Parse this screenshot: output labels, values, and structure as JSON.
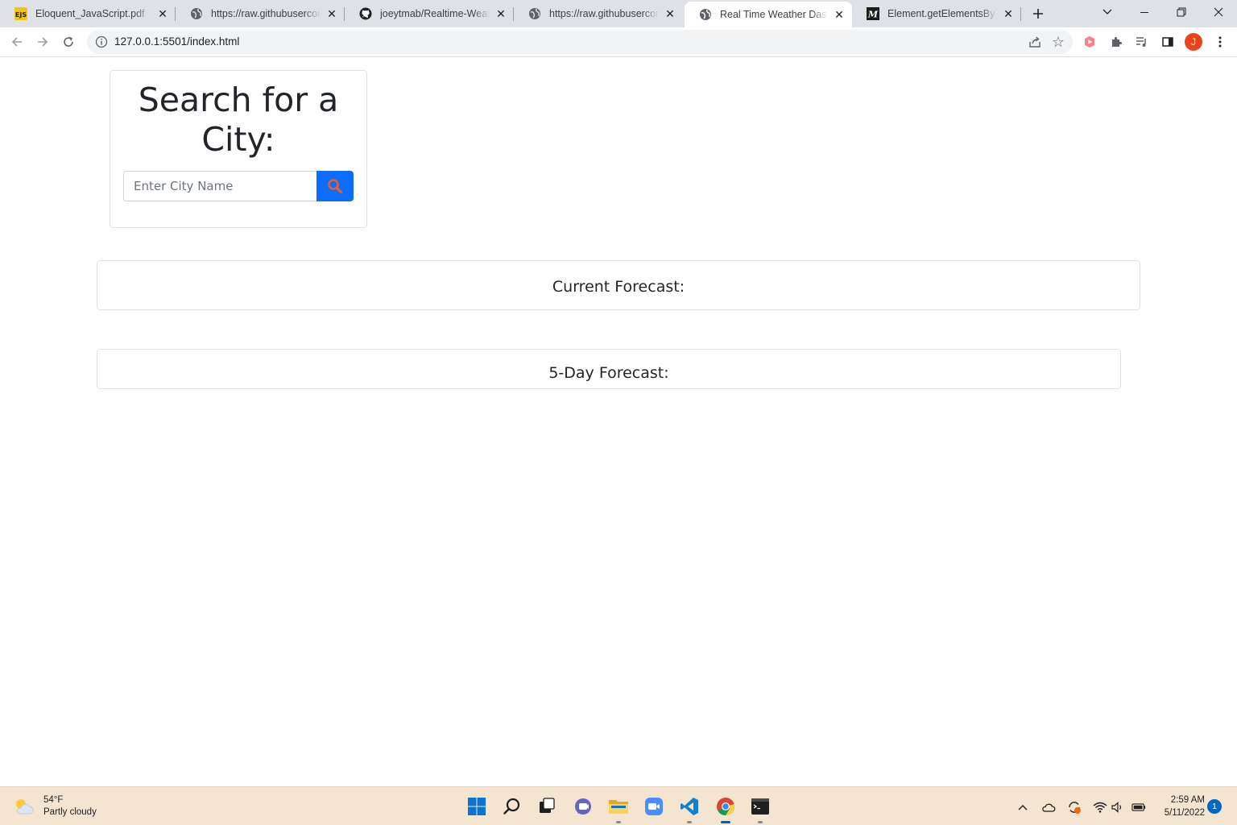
{
  "browser": {
    "tabs": [
      {
        "title": "Eloquent_JavaScript.pdf",
        "icon": "ejs-pdf-icon",
        "active": false
      },
      {
        "title": "https://raw.githubuserconte",
        "icon": "globe-icon",
        "active": false
      },
      {
        "title": "joeytmab/Realtime-Weathe",
        "icon": "github-icon",
        "active": false
      },
      {
        "title": "https://raw.githubuserconte",
        "icon": "globe-icon",
        "active": false
      },
      {
        "title": "Real Time Weather Dashbo",
        "icon": "globe-icon",
        "active": true
      },
      {
        "title": "Element.getElementsByTag",
        "icon": "mdn-icon",
        "active": false
      }
    ],
    "favicon_labels": {
      "ejs": "EJS",
      "mdn": "M"
    },
    "address": "127.0.0.1:5501/index.html",
    "profile_initial": "J",
    "colors": {
      "tab_strip": "#dee1e6",
      "profile": "#e8431a"
    }
  },
  "page": {
    "search": {
      "title": "Search for a City:",
      "placeholder": "Enter City Name",
      "value": ""
    },
    "current_forecast": {
      "title": "Current Forecast:"
    },
    "five_day_forecast": {
      "title": "5-Day Forecast:"
    },
    "colors": {
      "button": "#0d6efd",
      "search_icon": "#f15a22",
      "text": "#212529"
    }
  },
  "taskbar": {
    "weather": {
      "temp": "54°F",
      "condition": "Partly cloudy"
    },
    "apps": [
      "start-icon",
      "search-icon",
      "task-view-icon",
      "chat-icon",
      "file-explorer-icon",
      "zoom-icon",
      "vscode-icon",
      "chrome-icon",
      "terminal-icon"
    ],
    "clock": {
      "time": "2:59 AM",
      "date": "5/11/2022"
    },
    "notifications": "1",
    "colors": {
      "background": "#f3e5d0"
    }
  }
}
